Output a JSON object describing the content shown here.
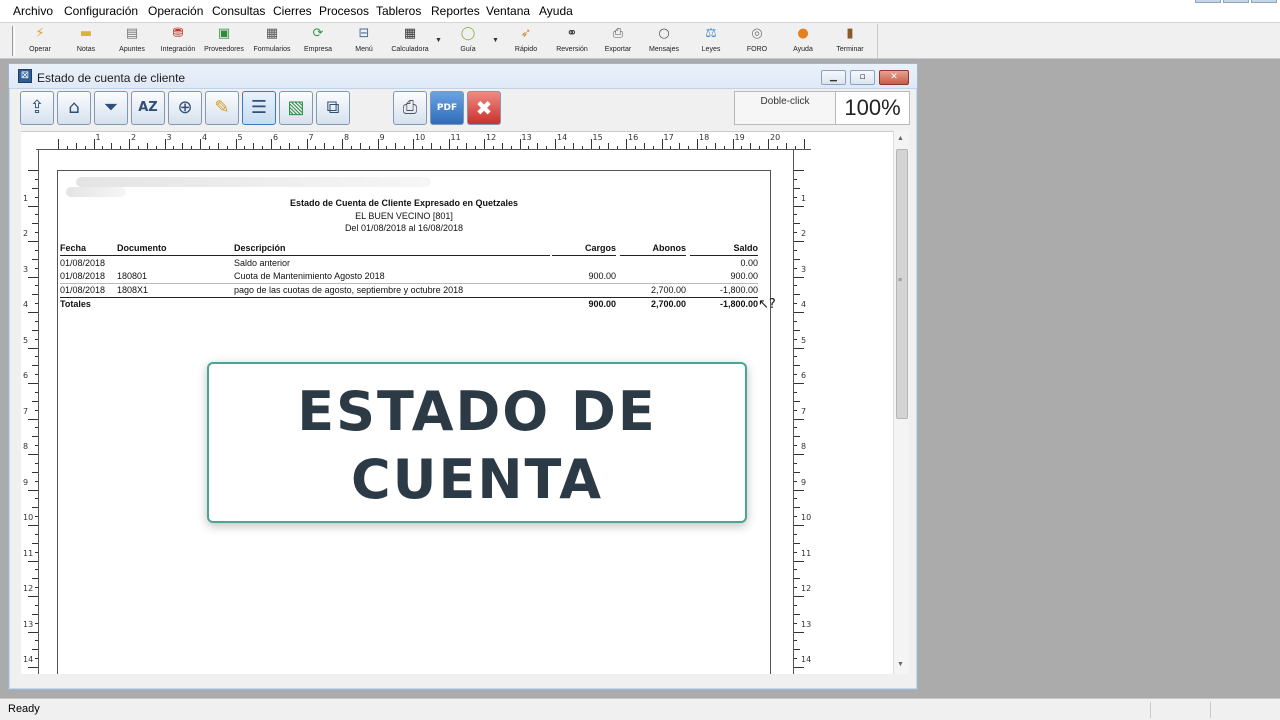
{
  "menubar": {
    "items": [
      "Archivo",
      "Configuración",
      "Operación",
      "Consultas",
      "Cierres",
      "Procesos",
      "Tableros",
      "Reportes",
      "Ventana",
      "Ayuda"
    ]
  },
  "toolbar": {
    "buttons": [
      {
        "label": "Operar",
        "icon": "lightning-icon"
      },
      {
        "label": "Notas",
        "icon": "notes-icon"
      },
      {
        "label": "Apuntes",
        "icon": "ledger-icon"
      },
      {
        "label": "Integración",
        "icon": "integration-icon"
      },
      {
        "label": "Proveedores",
        "icon": "supplier-icon"
      },
      {
        "label": "Formularios",
        "icon": "forms-icon"
      },
      {
        "label": "Empresa",
        "icon": "sync-icon"
      },
      {
        "label": "Menú",
        "icon": "menu-icon"
      },
      {
        "label": "Calculadora",
        "icon": "calculator-icon"
      },
      {
        "label": "Guía",
        "icon": "chat-icon"
      },
      {
        "label": "Rápido",
        "icon": "rocket-icon"
      },
      {
        "label": "Reversión",
        "icon": "binoculars-icon"
      },
      {
        "label": "Exportar",
        "icon": "export-icon"
      },
      {
        "label": "Mensajes",
        "icon": "message-icon"
      },
      {
        "label": "Leyes",
        "icon": "laws-icon"
      },
      {
        "label": "FORO",
        "icon": "forum-icon"
      },
      {
        "label": "Ayuda",
        "icon": "help-icon"
      },
      {
        "label": "Terminar",
        "icon": "exit-door-icon"
      }
    ]
  },
  "child_window": {
    "title": "Estado de cuenta de cliente",
    "report_toolbar": {
      "doble_click_label": "Doble-click",
      "zoom": "100%",
      "pdf_label": "PDF"
    }
  },
  "report": {
    "title": "Estado de Cuenta de Cliente Expresado en Quetzales",
    "client": "EL BUEN VECINO [801]",
    "period": "Del 01/08/2018 al 16/08/2018",
    "columns": [
      "Fecha",
      "Documento",
      "Descripción",
      "Cargos",
      "Abonos",
      "Saldo"
    ],
    "rows": [
      {
        "fecha": "01/08/2018",
        "documento": "",
        "descripcion": "Saldo anterior",
        "cargos": "",
        "abonos": "",
        "saldo": "0.00"
      },
      {
        "fecha": "01/08/2018",
        "documento": "180801",
        "descripcion": "Cuota de Mantenimiento Agosto 2018",
        "cargos": "900.00",
        "abonos": "",
        "saldo": "900.00"
      },
      {
        "fecha": "01/08/2018",
        "documento": "1808X1",
        "descripcion": "pago de las cuotas de agosto, septiembre y octubre 2018",
        "cargos": "",
        "abonos": "2,700.00",
        "saldo": "-1,800.00"
      }
    ],
    "totals": {
      "label": "Totales",
      "cargos": "900.00",
      "abonos": "2,700.00",
      "saldo": "-1,800.00"
    }
  },
  "overlay": {
    "line1": "ESTADO DE",
    "line2": "CUENTA"
  },
  "statusbar": {
    "text": "Ready"
  },
  "colors": {
    "overlay_border": "#4aa596",
    "overlay_text": "#2b3a45"
  }
}
